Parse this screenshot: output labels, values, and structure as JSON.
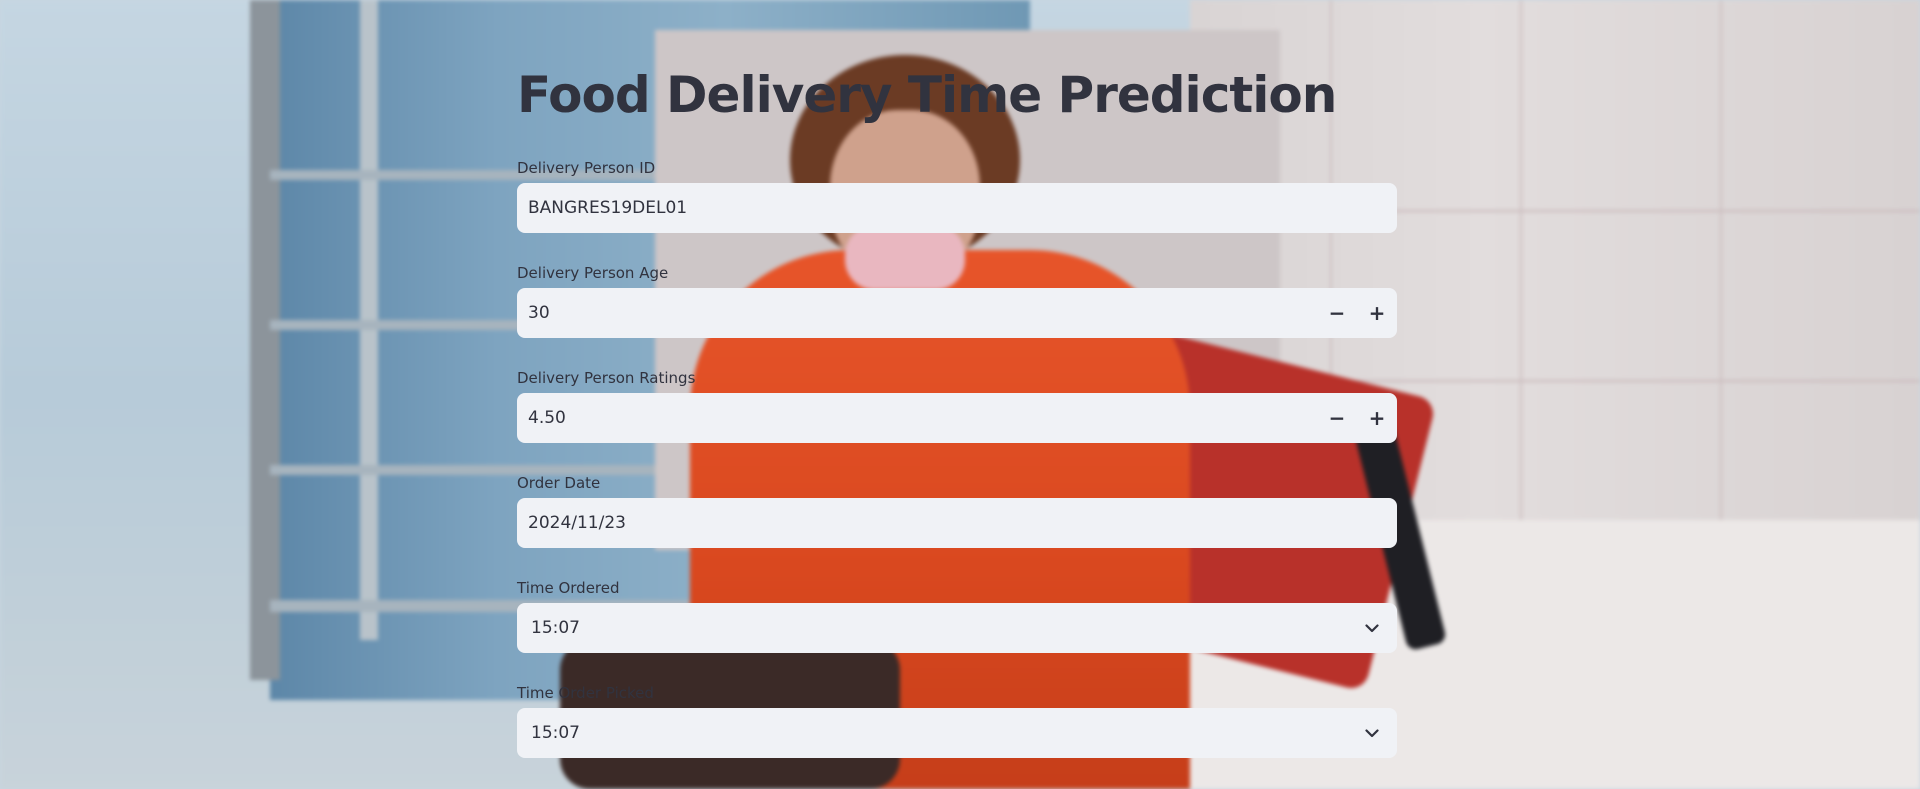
{
  "page": {
    "title": "Food Delivery Time Prediction"
  },
  "form": {
    "delivery_person_id": {
      "label": "Delivery Person ID",
      "value": "BANGRES19DEL01"
    },
    "delivery_person_age": {
      "label": "Delivery Person Age",
      "value": "30",
      "decrement": "−",
      "increment": "+"
    },
    "delivery_person_ratings": {
      "label": "Delivery Person Ratings",
      "value": "4.50",
      "decrement": "−",
      "increment": "+"
    },
    "order_date": {
      "label": "Order Date",
      "value": "2024/11/23"
    },
    "time_ordered": {
      "label": "Time Ordered",
      "value": "15:07"
    },
    "time_order_picked": {
      "label": "Time Order Picked",
      "value": "15:07"
    }
  },
  "icons": {
    "dropdown": "chevron-down-icon"
  },
  "colors": {
    "text": "#31333f",
    "input_background": "#f0f2f6",
    "jacket": "#e7552a"
  }
}
